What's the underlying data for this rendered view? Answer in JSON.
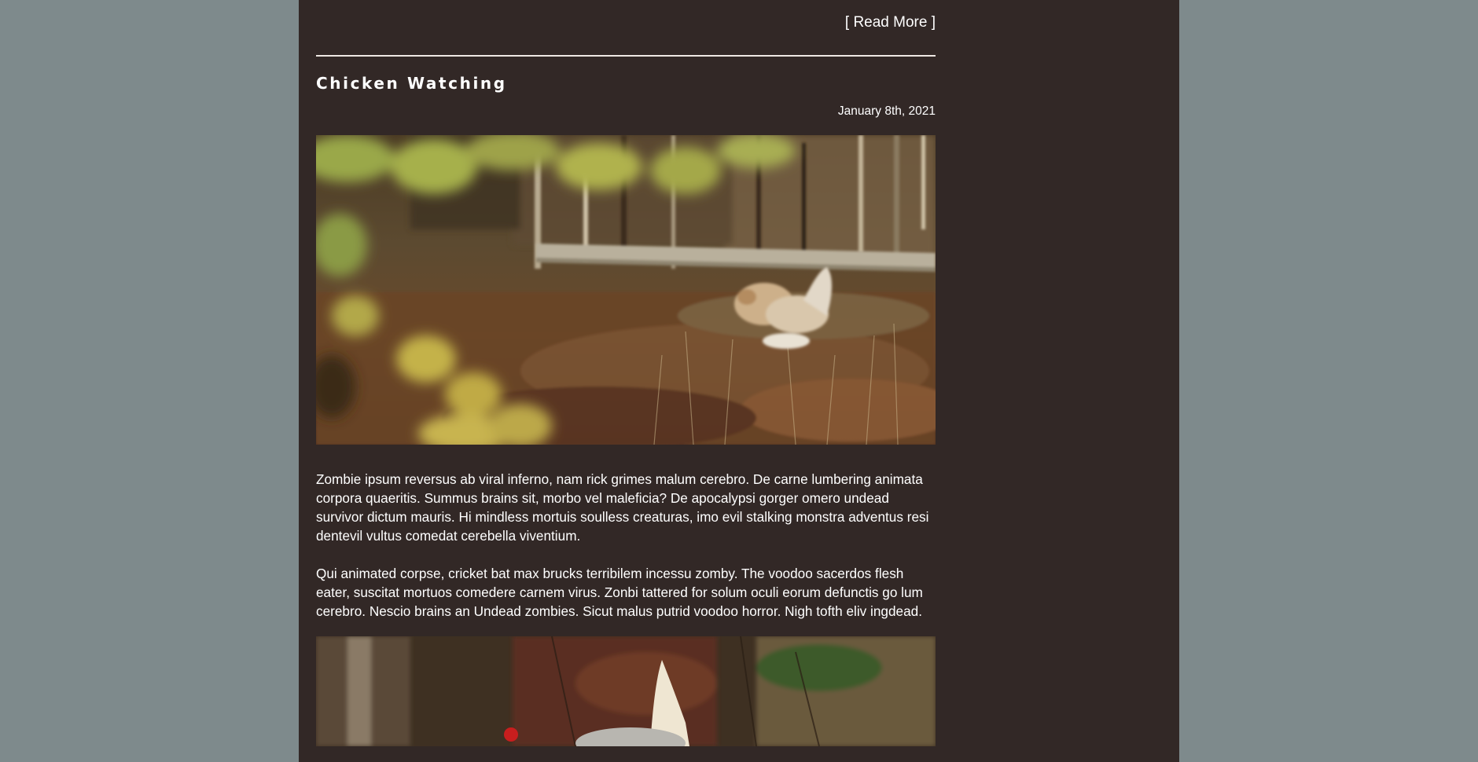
{
  "read_more_label": "[ Read More ]",
  "post": {
    "title": "Chicken Watching",
    "date": "January 8th, 2021",
    "paragraphs": [
      "Zombie ipsum reversus ab viral inferno, nam rick grimes malum cerebro. De carne lumbering animata corpora quaeritis. Summus brains sit, morbo vel maleficia? De apocalypsi gorger omero undead survivor dictum mauris. Hi mindless mortuis soulless creaturas, imo evil stalking monstra adventus resi dentevil vultus comedat cerebella viventium.",
      "Qui animated corpse, cricket bat max brucks terribilem incessu zomby. The voodoo sacerdos flesh eater, suscitat mortuos comedere carnem virus. Zonbi tattered for solum oculi eorum defunctis go lum cerebro. Nescio brains an Undead zombies. Sicut malus putrid voodoo horror. Nigh tofth eliv ingdead."
    ]
  },
  "colors": {
    "page_background": "#7e8a8c",
    "content_background": "#322826",
    "text": "#ffffff"
  }
}
